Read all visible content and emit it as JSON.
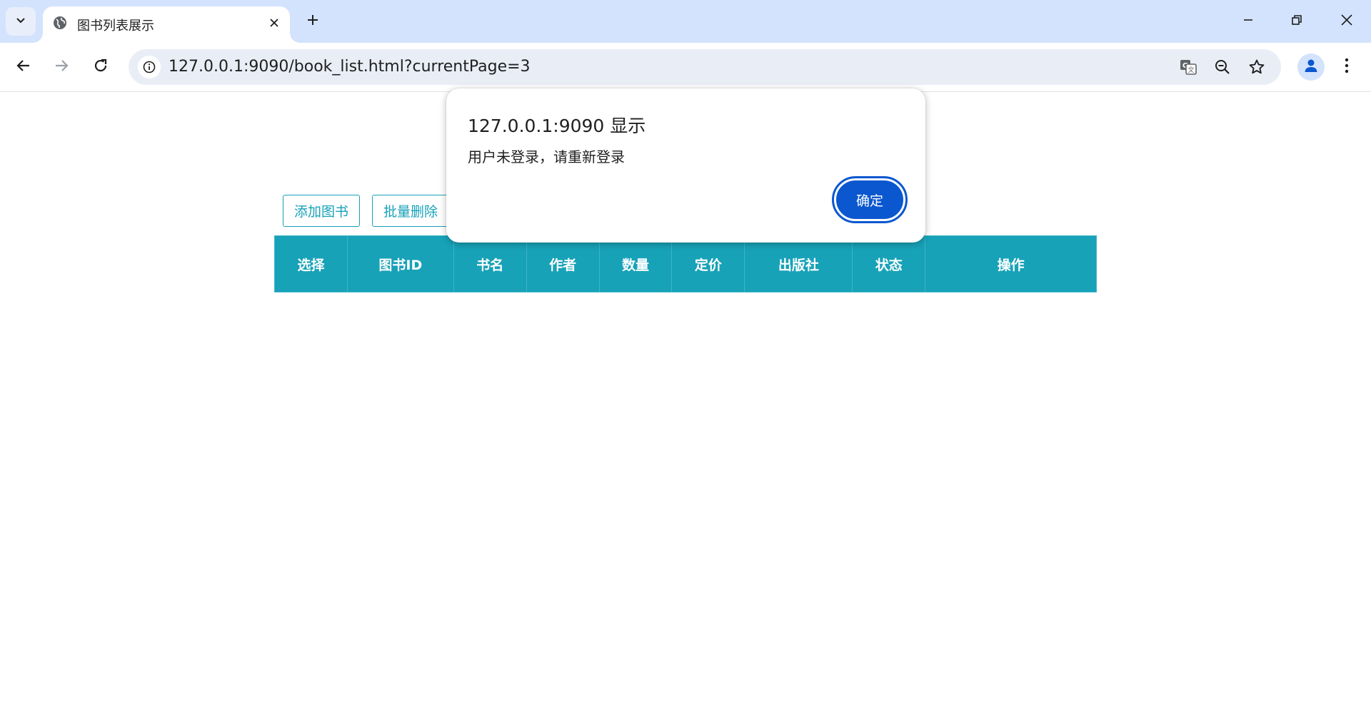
{
  "browser": {
    "tab": {
      "title": "图书列表展示"
    },
    "url": "127.0.0.1:9090/book_list.html?currentPage=3"
  },
  "page": {
    "buttons": {
      "add_book": "添加图书",
      "batch_delete": "批量删除"
    },
    "table": {
      "headers": [
        "选择",
        "图书ID",
        "书名",
        "作者",
        "数量",
        "定价",
        "出版社",
        "状态",
        "操作"
      ]
    }
  },
  "dialog": {
    "title": "127.0.0.1:9090 显示",
    "message": "用户未登录，请重新登录",
    "ok_label": "确定"
  },
  "colors": {
    "accent": "#17a2b8",
    "dialog_button": "#0b57d0",
    "tabstrip": "#d3e3fd"
  }
}
